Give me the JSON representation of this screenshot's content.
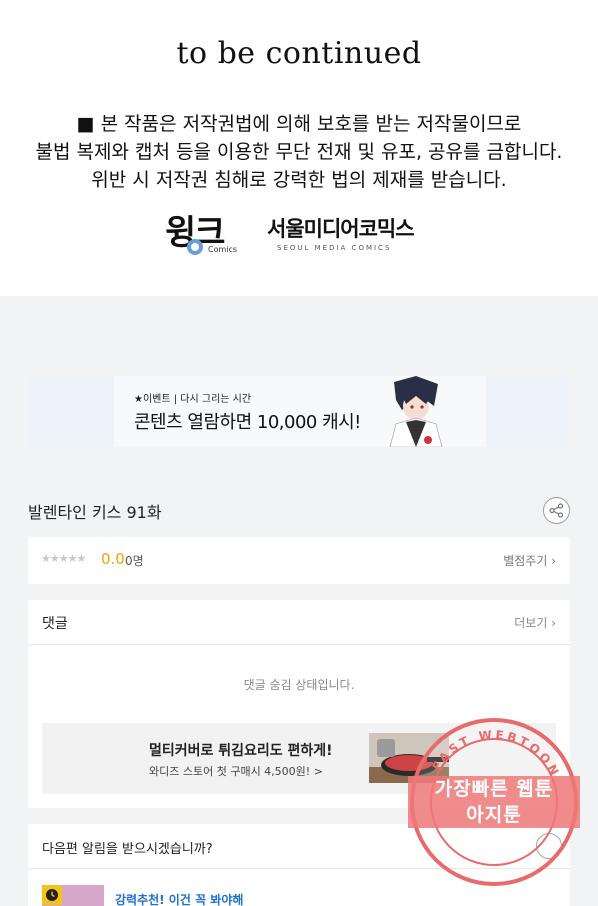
{
  "notice": {
    "ending": "to be continued",
    "copyright_lines": [
      "■ 본 작품은 저작권법에 의해 보호를 받는 저작물이므로",
      "불법 복제와 캡처 등을 이용한 무단 전재 및 유포, 공유를 금합니다.",
      "위반 시 저작권 침해로 강력한 법의 제재를 받습니다."
    ],
    "logo1": {
      "text": "윙크",
      "sub": "Comics"
    },
    "logo2": {
      "text": "서울미디어코믹스",
      "sub": "SEOUL MEDIA COMICS"
    }
  },
  "banner": {
    "tag": "★이벤트 | 다시 그리는 시간",
    "title": "콘텐츠 열람하면 10,000 캐시!"
  },
  "episode": {
    "title": "발렌타인 키스 91화"
  },
  "rating": {
    "stars": "★★★★★",
    "score": "0.0",
    "count": "0명",
    "rate_link": "별점주기 ›"
  },
  "comments": {
    "title": "댓글",
    "more": "더보기 ›",
    "hidden_message": "댓글 숨김 상태입니다."
  },
  "ad": {
    "title": "멀티커버로 튀김요리도 편하게!",
    "subtitle": "와디즈 스토어 첫 구매시 4,500원! >"
  },
  "alarm": {
    "question": "다음편 알림을 받으시겠습니까?",
    "recommend": "강력추천! 이건 꼭 봐야해"
  },
  "watermark": {
    "line1": "가장빠른 웹툰",
    "line2": "아지툰",
    "ring_text": "FAST WEBTOON"
  },
  "colors": {
    "score": "#f0a400",
    "link": "#1e6fd0",
    "watermark": "#e86a6a"
  }
}
